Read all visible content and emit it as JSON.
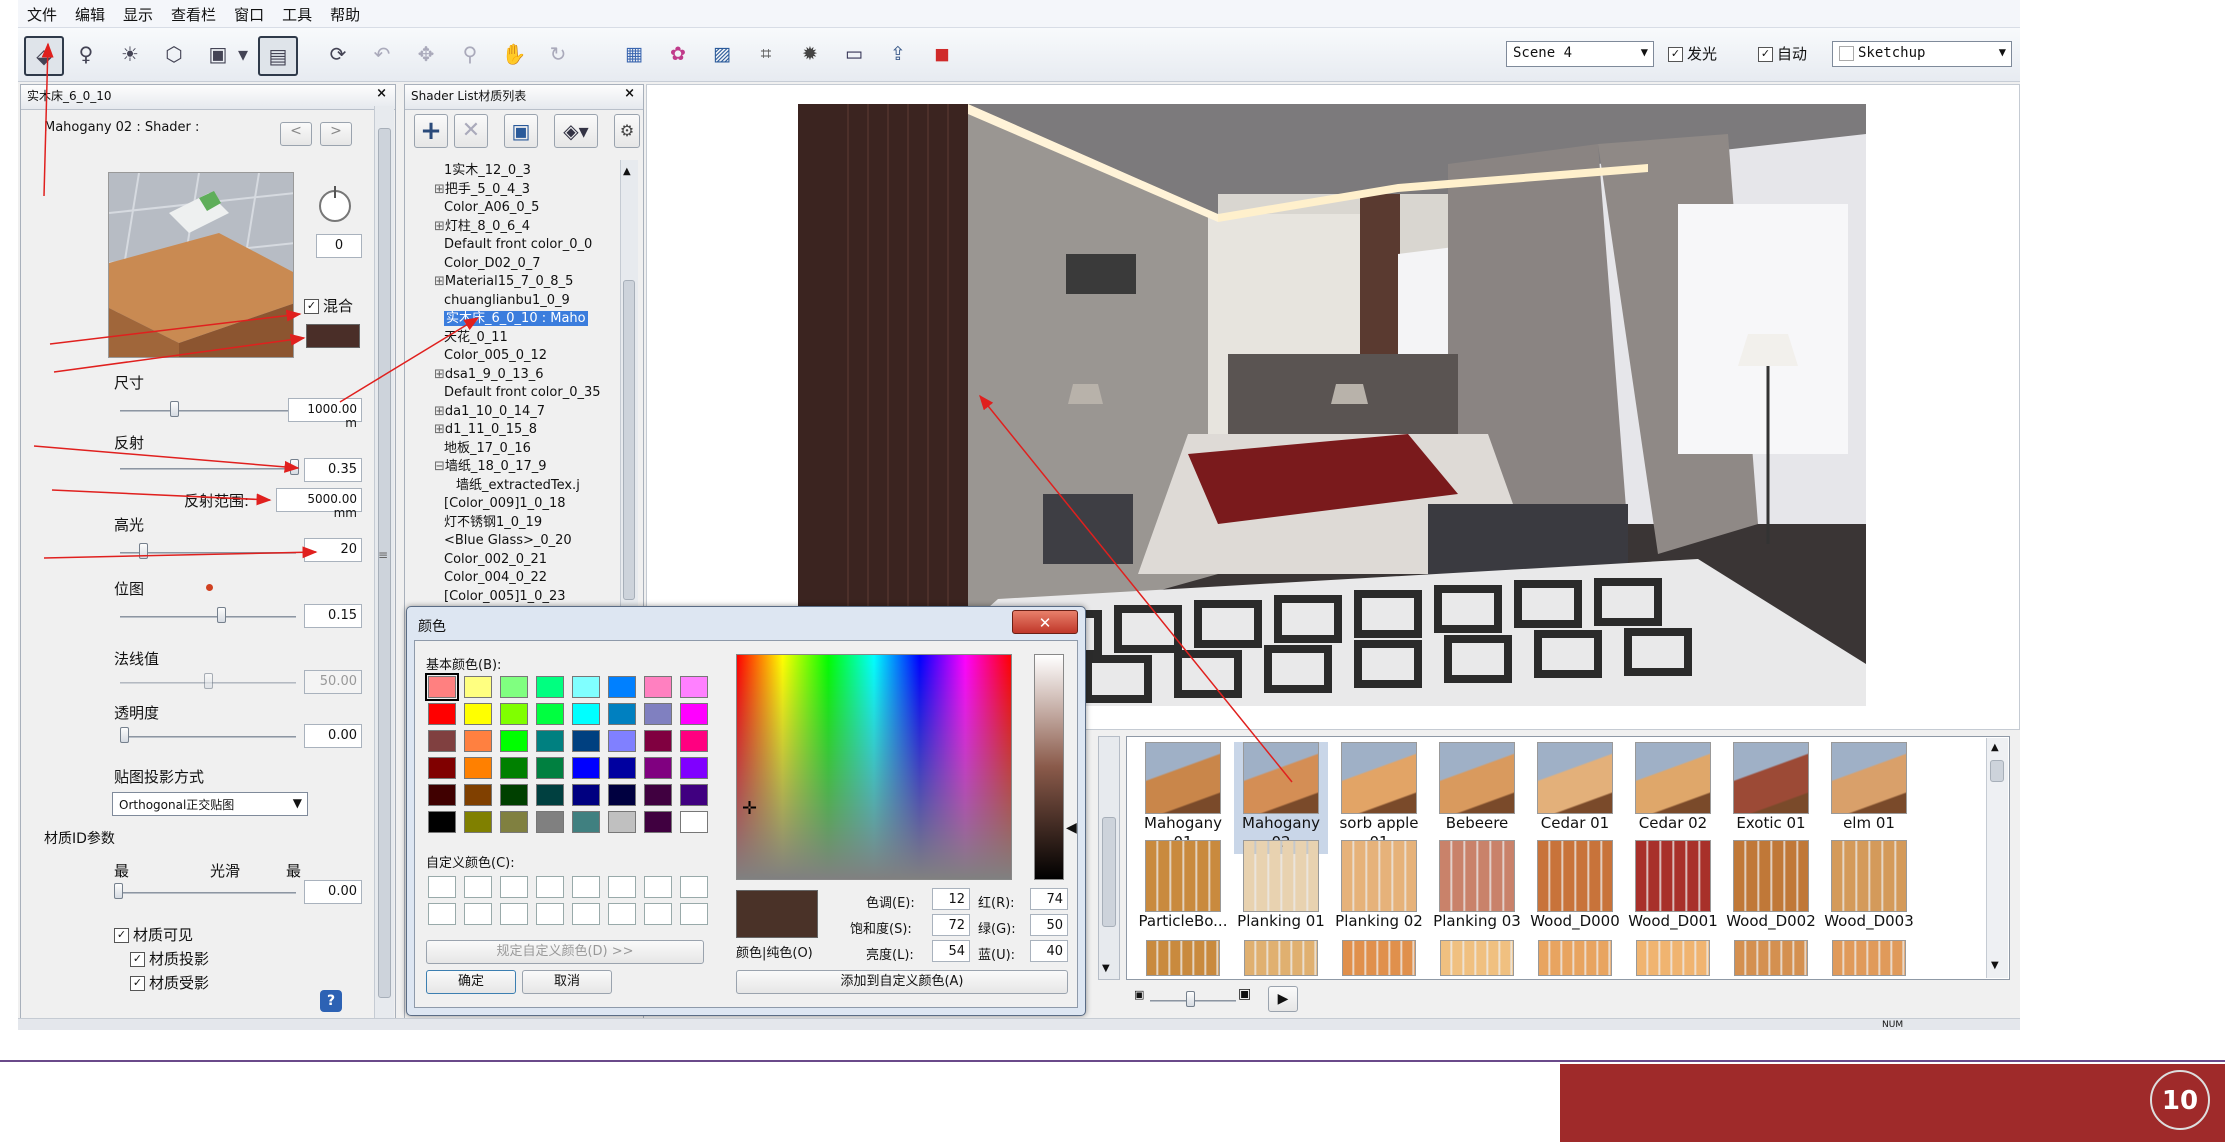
{
  "menu": [
    "文件",
    "编辑",
    "显示",
    "查看栏",
    "窗口",
    "工具",
    "帮助"
  ],
  "toolbar": {
    "icons": [
      "pick-material-icon",
      "light-bulb-icon",
      "sun-icon",
      "object-icon",
      "camera-icon",
      "dropdown-arrow-icon",
      "panel-icon",
      "rotate-view-icon",
      "undo-icon",
      "pan-icon",
      "zoom-icon",
      "hand-icon",
      "orbit-icon",
      "render-region-icon",
      "material-editor-icon",
      "image-icon",
      "crop-icon",
      "settings-icon",
      "window-icon",
      "export-icon",
      "render-icon"
    ],
    "scene_select": "Scene 4",
    "glow_label": "发光",
    "glow_checked": true,
    "auto_label": "自动",
    "auto_checked": true,
    "sketchup_select": "Sketchup"
  },
  "material_panel": {
    "title": "实木床_6_0_10",
    "shader_label": "Mahogany 02 : Shader :",
    "prev": "<",
    "next": ">",
    "rotation_value": "0",
    "blend_label": "混合",
    "blend_checked": true,
    "swatch_color": "#4a2e28",
    "size_label": "尺寸",
    "size_value": "1000.00 m",
    "size_pct": 0.3,
    "reflect_label": "反射",
    "reflect_value": "0.35",
    "reflect_pct": 0.98,
    "reflect_range_label": "反射范围:",
    "reflect_range_value": "5000.00 mm",
    "highlight_label": "高光",
    "highlight_value": "20",
    "highlight_pct": 0.14,
    "bump_label": "位图",
    "bump_value": "0.15",
    "bump_pct": 0.58,
    "normal_label": "法线值",
    "normal_value": "50.00",
    "normal_pct": 0.5,
    "opacity_label": "透明度",
    "opacity_value": "0.00",
    "opacity_pct": 0.0,
    "projection_label": "贴图投影方式",
    "projection_select": "Orthogonal正交贴图",
    "id_params_label": "材质ID参数",
    "min_label": "最",
    "smooth_label": "光滑",
    "max_label": "最",
    "smooth_value": "0.00",
    "visible_label": "材质可见",
    "cast_shadow_label": "材质投影",
    "receive_shadow_label": "材质受影",
    "help": "?"
  },
  "shader_list": {
    "title": "Shader List材质列表",
    "items": [
      {
        "text": "1实木_12_0_3",
        "expand": ""
      },
      {
        "text": "把手_5_0_4_3",
        "expand": "⊞"
      },
      {
        "text": "Color_A06_0_5",
        "expand": ""
      },
      {
        "text": "灯柱_8_0_6_4",
        "expand": "⊞"
      },
      {
        "text": "Default front color_0_0",
        "expand": ""
      },
      {
        "text": "Color_D02_0_7",
        "expand": ""
      },
      {
        "text": "Material15_7_0_8_5",
        "expand": "⊞"
      },
      {
        "text": "chuanglianbu1_0_9",
        "expand": ""
      },
      {
        "text": "实木床_6_0_10 : Maho",
        "expand": "",
        "selected": true
      },
      {
        "text": "天花_0_11",
        "expand": ""
      },
      {
        "text": "Color_005_0_12",
        "expand": ""
      },
      {
        "text": "dsa1_9_0_13_6",
        "expand": "⊞"
      },
      {
        "text": "Default front color_0_35",
        "expand": ""
      },
      {
        "text": "da1_10_0_14_7",
        "expand": "⊞"
      },
      {
        "text": "d1_11_0_15_8",
        "expand": "⊞"
      },
      {
        "text": "地板_17_0_16",
        "expand": ""
      },
      {
        "text": "墙纸_18_0_17_9",
        "expand": "⊟"
      },
      {
        "text": "墙纸_extractedTex.j",
        "expand": "",
        "indent": true
      },
      {
        "text": "[Color_009]1_0_18",
        "expand": ""
      },
      {
        "text": "灯不锈钢1_0_19",
        "expand": ""
      },
      {
        "text": "<Blue Glass>_0_20",
        "expand": ""
      },
      {
        "text": "Color_002_0_21",
        "expand": ""
      },
      {
        "text": "Color_004_0_22",
        "expand": ""
      },
      {
        "text": "[Color_005]1_0_23",
        "expand": ""
      }
    ]
  },
  "color_dialog": {
    "title": "颜色",
    "close": "✕",
    "basic_label": "基本颜色(B):",
    "basic_colors": [
      "#ff8080",
      "#ffff80",
      "#80ff80",
      "#00ff80",
      "#80ffff",
      "#0080ff",
      "#ff80c0",
      "#ff80ff",
      "#ff0000",
      "#ffff00",
      "#80ff00",
      "#00ff40",
      "#00ffff",
      "#0080c0",
      "#8080c0",
      "#ff00ff",
      "#804040",
      "#ff8040",
      "#00ff00",
      "#008080",
      "#004080",
      "#8080ff",
      "#800040",
      "#ff0080",
      "#800000",
      "#ff8000",
      "#008000",
      "#008040",
      "#0000ff",
      "#0000a0",
      "#800080",
      "#8000ff",
      "#400000",
      "#804000",
      "#004000",
      "#004040",
      "#000080",
      "#000040",
      "#400040",
      "#400080",
      "#000000",
      "#808000",
      "#808040",
      "#808080",
      "#408080",
      "#c0c0c0",
      "#400040",
      "#ffffff"
    ],
    "custom_label": "自定义颜色(C):",
    "define_btn": "规定自定义颜色(D) >>",
    "ok": "确定",
    "cancel": "取消",
    "hue_label": "色调(E):",
    "hue": "12",
    "sat_label": "饱和度(S):",
    "sat": "72",
    "lum_label": "亮度(L):",
    "lum": "54",
    "red_label": "红(R):",
    "red": "74",
    "green_label": "绿(G):",
    "green": "50",
    "blue_label": "蓝(U):",
    "blue": "40",
    "color_solid_label": "颜色|纯色(O)",
    "current_color": "#4a3228",
    "add_custom": "添加到自定义颜色(A)"
  },
  "library": {
    "row1": [
      {
        "label": "Mahogany 01",
        "color": "#c9864a"
      },
      {
        "label": "Mahogany 02",
        "color": "#d48e55",
        "selected": true
      },
      {
        "label": "sorb apple 01",
        "color": "#e2a466"
      },
      {
        "label": "Bebeere",
        "color": "#d99a5e"
      },
      {
        "label": "Cedar 01",
        "color": "#e3b07a"
      },
      {
        "label": "Cedar 02",
        "color": "#dfa76a"
      },
      {
        "label": "Exotic 01",
        "color": "#9c4a36"
      },
      {
        "label": "elm 01",
        "color": "#d9a06a"
      }
    ],
    "row2": [
      {
        "label": "ParticleBo...",
        "color": "#c98a3e"
      },
      {
        "label": "Planking 01",
        "color": "#e8d2b0"
      },
      {
        "label": "Planking 02",
        "color": "#e6b27a"
      },
      {
        "label": "Planking 03",
        "color": "#c9826a"
      },
      {
        "label": "Wood_D000",
        "color": "#c8733a"
      },
      {
        "label": "Wood_D001",
        "color": "#a8302a"
      },
      {
        "label": "Wood_D002",
        "color": "#c07838"
      },
      {
        "label": "Wood_D003",
        "color": "#d49a5a"
      }
    ],
    "row3_colors": [
      "#c98a3e",
      "#e0b070",
      "#e0904c",
      "#f0c080",
      "#e8a460",
      "#f0b470",
      "#d49050",
      "#e09a5a"
    ],
    "play": "▶"
  },
  "status": "NUM",
  "logo_text": "10"
}
